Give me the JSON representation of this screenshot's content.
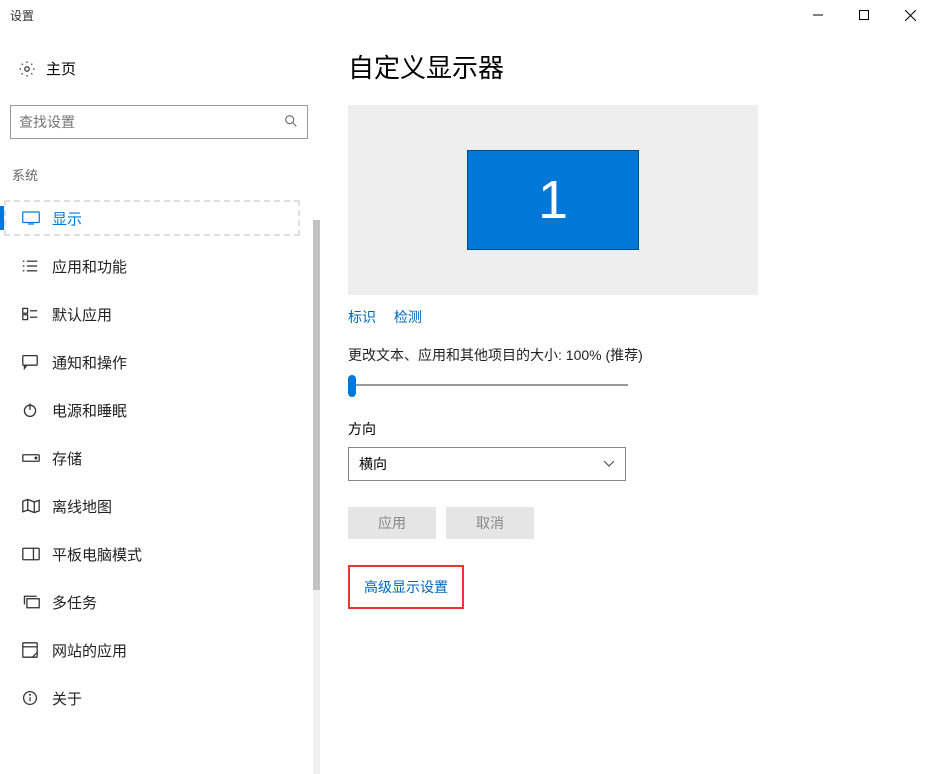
{
  "window": {
    "title": "设置"
  },
  "sidebar": {
    "home": "主页",
    "search_placeholder": "查找设置",
    "group": "系统",
    "items": [
      {
        "label": "显示",
        "active": true
      },
      {
        "label": "应用和功能"
      },
      {
        "label": "默认应用"
      },
      {
        "label": "通知和操作"
      },
      {
        "label": "电源和睡眠"
      },
      {
        "label": "存储"
      },
      {
        "label": "离线地图"
      },
      {
        "label": "平板电脑模式"
      },
      {
        "label": "多任务"
      },
      {
        "label": "网站的应用"
      },
      {
        "label": "关于"
      }
    ]
  },
  "main": {
    "title": "自定义显示器",
    "monitor_number": "1",
    "identify": "标识",
    "detect": "检测",
    "scale_label": "更改文本、应用和其他项目的大小: 100% (推荐)",
    "orientation_label": "方向",
    "orientation_value": "横向",
    "apply": "应用",
    "cancel": "取消",
    "advanced": "高级显示设置"
  }
}
